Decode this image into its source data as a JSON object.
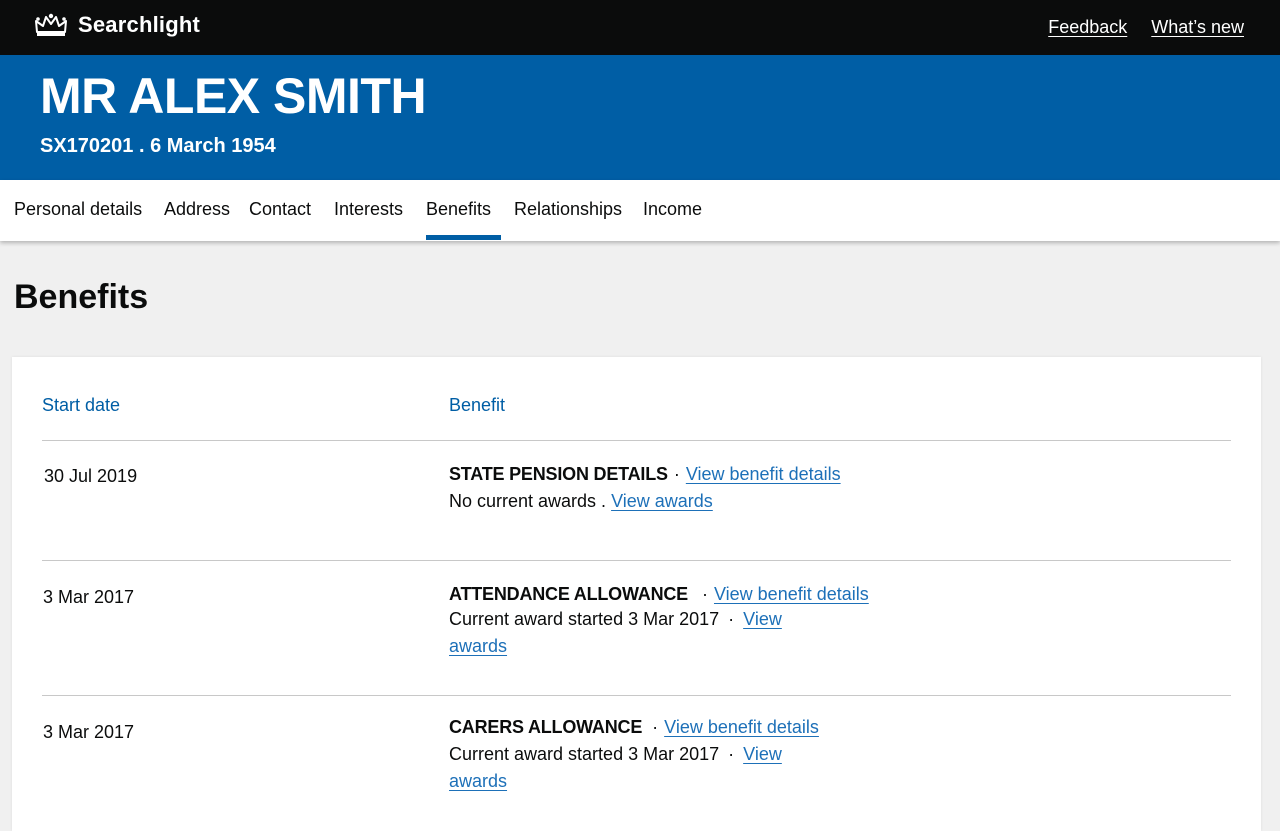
{
  "header": {
    "brand": "Searchlight",
    "links": [
      "Feedback",
      "What’s new"
    ]
  },
  "person": {
    "name": "MR ALEX SMITH",
    "sub": "SX170201 . 6 March 1954"
  },
  "nav": {
    "tabs": [
      "Personal details",
      "Address",
      "Contact",
      "Interests",
      "Benefits",
      "Relationships",
      "Income"
    ],
    "active": "Benefits"
  },
  "page": {
    "title": "Benefits"
  },
  "table": {
    "headers": {
      "start_date": "Start date",
      "benefit": "Benefit"
    },
    "rows": [
      {
        "date": "30 Jul 2019",
        "name": "STATE PENSION DETAILS",
        "details_link": "View benefit details",
        "status": "No current awards .",
        "awards_link": "View awards"
      },
      {
        "date": "3 Mar 2017",
        "name": "ATTENDANCE ALLOWANCE",
        "details_link": "View benefit details",
        "status": "Current award started 3 Mar 2017",
        "awards_link_1": "View",
        "awards_link_2": "awards"
      },
      {
        "date": "3 Mar 2017",
        "name": "CARERS ALLOWANCE",
        "details_link": "View benefit details",
        "status": "Current award started 3 Mar 2017",
        "awards_link_1": "View",
        "awards_link_2": "awards"
      }
    ],
    "separator": "·"
  },
  "colors": {
    "header_bg": "#0b0c0c",
    "brand_blue": "#005ea5",
    "link": "#1d70b8"
  }
}
